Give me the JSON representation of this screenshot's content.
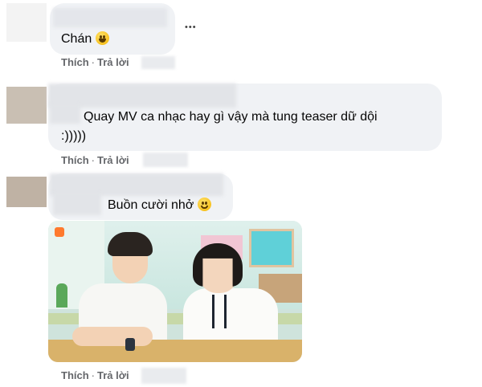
{
  "actions": {
    "like": "Thích",
    "reply": "Trả lời",
    "dot": "·"
  },
  "more_menu": "•••",
  "comments": [
    {
      "text": "Chán",
      "emoji": "laughing-face-icon"
    },
    {
      "line1": "Quay MV ca nhạc hay gì vậy mà tung teaser dữ dội",
      "line2": ":)))))"
    },
    {
      "text": "Buồn cười nhở",
      "emoji": "smiling-face-icon"
    }
  ],
  "colors": {
    "bubble": "#f0f2f5",
    "action_text": "#65676b",
    "text": "#050505"
  }
}
